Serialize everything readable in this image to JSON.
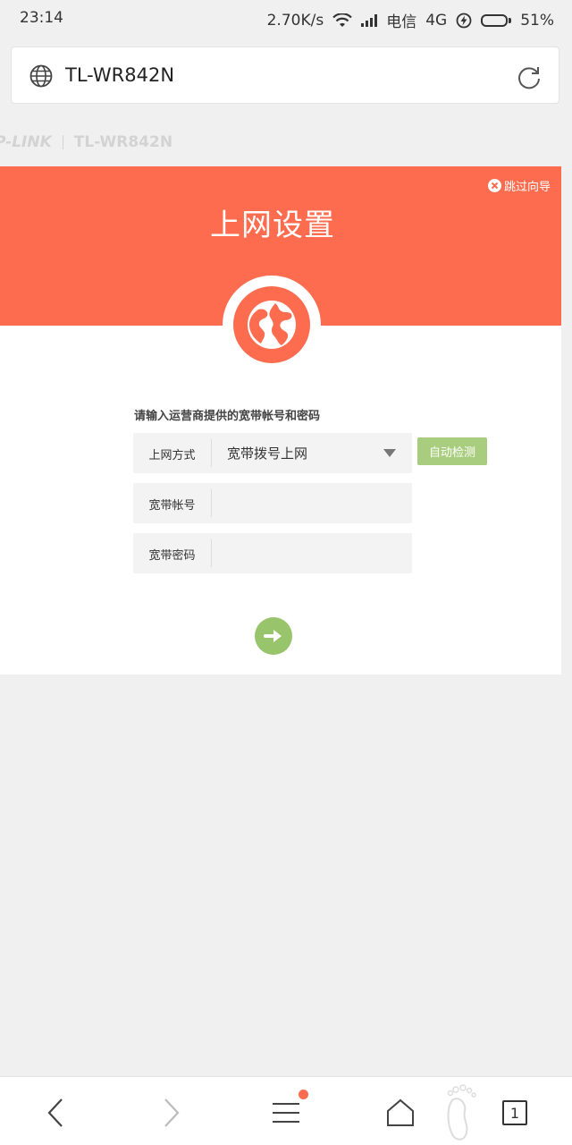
{
  "status_bar": {
    "time": "23:14",
    "speed": "2.70K/s",
    "carrier": "电信",
    "network": "4G",
    "battery": "51%",
    "battery_level": 0.51
  },
  "browser": {
    "url": "TL-WR842N"
  },
  "brand": {
    "logo": "P-LINK",
    "model": "TL-WR842N"
  },
  "wizard": {
    "skip_label": "跳过向导",
    "title": "上网设置",
    "instruction": "请输入运营商提供的宽带帐号和密码",
    "fields": [
      {
        "label": "上网方式",
        "value": "宽带拨号上网"
      },
      {
        "label": "宽带帐号",
        "value": ""
      },
      {
        "label": "宽带密码",
        "value": ""
      }
    ],
    "detect_label": "自动检测"
  },
  "bottom_nav": {
    "tab_count": "1"
  },
  "colors": {
    "accent": "#fd6c4f",
    "green": "#98c46b",
    "button_green": "#a8cd7e"
  },
  "icons": [
    "globe-icon",
    "reload-icon",
    "close-circle-icon",
    "earth-icon",
    "arrow-right-icon",
    "back-icon",
    "forward-icon",
    "menu-icon",
    "home-icon",
    "footprint-icon"
  ]
}
